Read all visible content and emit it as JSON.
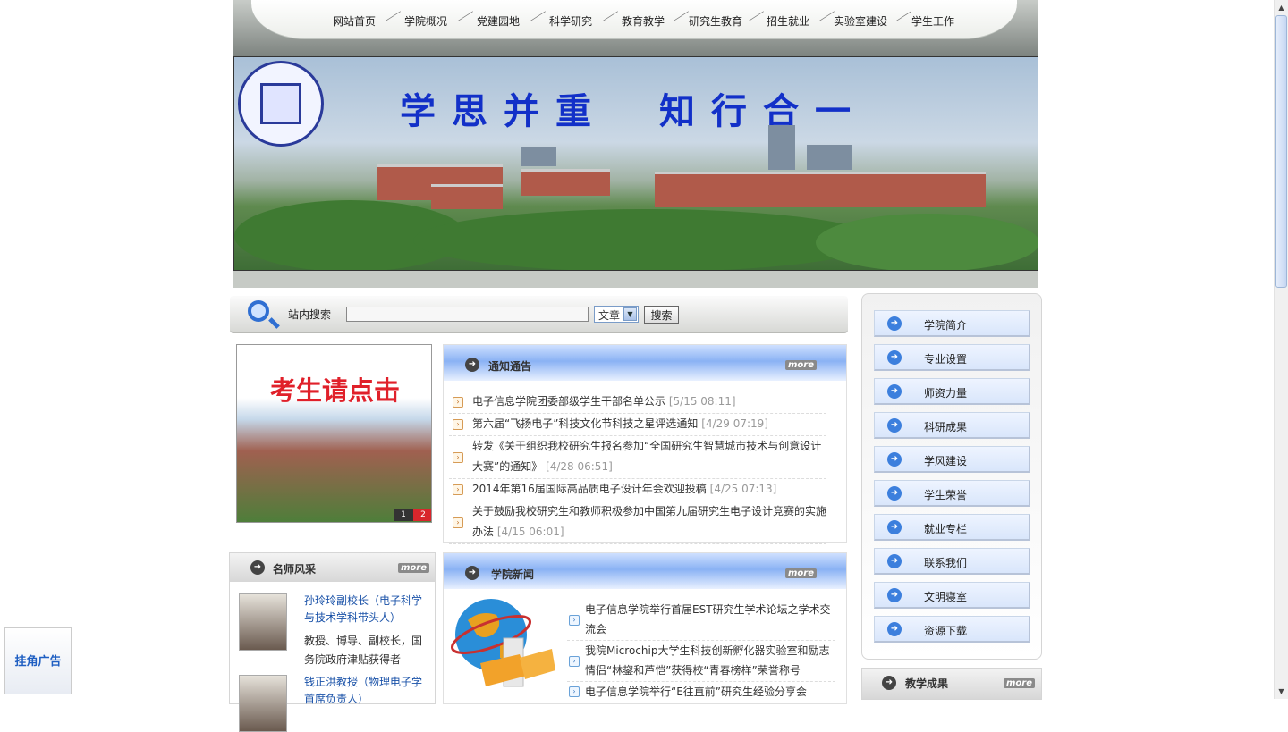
{
  "nav": {
    "items": [
      "网站首页",
      "学院概况",
      "党建园地",
      "科学研究",
      "教育教学",
      "研究生教育",
      "招生就业",
      "实验室建设",
      "学生工作"
    ]
  },
  "banner": {
    "slogan": "学思并重　知行合一"
  },
  "search": {
    "label": "站内搜索",
    "query": "",
    "select_value": "文章",
    "button": "搜索"
  },
  "promo": {
    "title": "考生请点击",
    "pages": [
      "1",
      "2"
    ]
  },
  "notices": {
    "title": "通知通告",
    "more": "more",
    "items": [
      {
        "text": "电子信息学院团委部级学生干部名单公示",
        "date": "[5/15 08:11]"
      },
      {
        "text": "第六届“飞扬电子”科技文化节科技之星评选通知",
        "date": "[4/29 07:19]"
      },
      {
        "text": "转发《关于组织我校研究生报名参加“全国研究生智慧城市技术与创意设计大赛”的通知》",
        "date": "[4/28 06:51]"
      },
      {
        "text": "2014年第16届国际高品质电子设计年会欢迎投稿",
        "date": "[4/25 07:13]"
      },
      {
        "text": "关于鼓励我校研究生和教师积极参加中国第九届研究生电子设计竞赛的实施办法",
        "date": "[4/15 06:01]"
      }
    ]
  },
  "teachers": {
    "title": "名师风采",
    "more": "more",
    "items": [
      {
        "name": "孙玲玲副校长（电子科学与技术学科带头人）",
        "desc": "教授、博导、副校长，国务院政府津贴获得者"
      },
      {
        "name": "钱正洪教授（物理电子学首席负责人）",
        "desc": ""
      }
    ]
  },
  "news": {
    "title": "学院新闻",
    "more": "more",
    "items": [
      "电子信息学院举行首届EST研究生学术论坛之学术交流会",
      "我院Microchip大学生科技创新孵化器实验室和励志情侣“林鋆和芦恺”获得校“青春榜样”荣誉称号",
      "电子信息学院举行“E往直前”研究生经验分享会"
    ]
  },
  "sidebar": {
    "items": [
      "学院简介",
      "专业设置",
      "师资力量",
      "科研成果",
      "学风建设",
      "学生荣誉",
      "就业专栏",
      "联系我们",
      "文明寝室",
      "资源下载"
    ]
  },
  "achievements": {
    "title": "教学成果",
    "more": "more"
  },
  "corner_ad": {
    "label": "挂角广告"
  }
}
